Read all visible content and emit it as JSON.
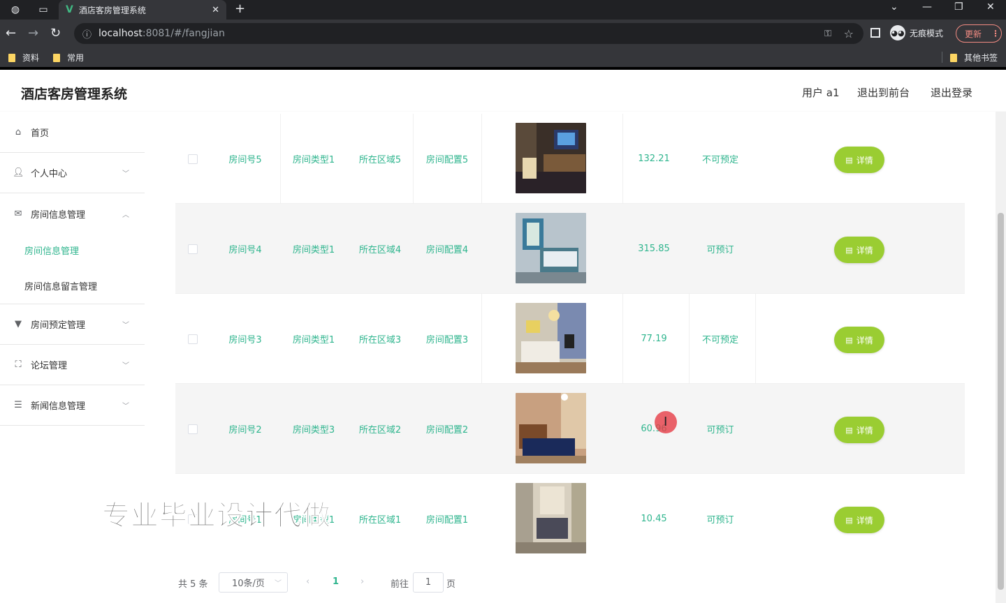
{
  "browser": {
    "tab_title": "酒店客房管理系统",
    "tab_logo": "V",
    "new_tab": "+",
    "url_host": "localhost",
    "url_rest": ":8081/#/fangjian",
    "incognito_label": "无痕模式",
    "update_label": "更新",
    "bookmarks": [
      "资料",
      "常用"
    ],
    "other_bookmarks": "其他书签"
  },
  "header": {
    "title": "酒店客房管理系统",
    "user": "用户 a1",
    "to_front": "退出到前台",
    "logout": "退出登录"
  },
  "sidebar": {
    "items": [
      {
        "label": "首页",
        "icon": "home-icon"
      },
      {
        "label": "个人中心",
        "icon": "user-icon"
      },
      {
        "label": "房间信息管理",
        "icon": "mail-icon"
      },
      {
        "label": "房间预定管理",
        "icon": "booking-icon"
      },
      {
        "label": "论坛管理",
        "icon": "forum-icon"
      },
      {
        "label": "新闻信息管理",
        "icon": "news-icon"
      }
    ],
    "sub_items": [
      "房间信息管理",
      "房间信息留言管理"
    ]
  },
  "table": {
    "detail_label": "详情",
    "rows": [
      {
        "room_no": "房间号5",
        "type": "房间类型1",
        "area": "所在区域5",
        "config": "房间配置5",
        "price": "132.21",
        "status": "不可预定"
      },
      {
        "room_no": "房间号4",
        "type": "房间类型1",
        "area": "所在区域4",
        "config": "房间配置4",
        "price": "315.85",
        "status": "可预订"
      },
      {
        "room_no": "房间号3",
        "type": "房间类型1",
        "area": "所在区域3",
        "config": "房间配置3",
        "price": "77.19",
        "status": "不可预定"
      },
      {
        "room_no": "房间号2",
        "type": "房间类型3",
        "area": "所在区域2",
        "config": "房间配置2",
        "price": "60.96",
        "status": "可预订"
      },
      {
        "room_no": "房间号1",
        "type": "房间类型1",
        "area": "所在区域1",
        "config": "房间配置1",
        "price": "10.45",
        "status": "可预订"
      }
    ]
  },
  "pagination": {
    "total": "共 5 条",
    "page_size": "10条/页",
    "current": "1",
    "goto_label": "前往",
    "goto_value": "1",
    "page_suffix": "页"
  },
  "overlay": {
    "watermark": "专业毕业设计代做",
    "cursor": "I"
  },
  "colors": {
    "accent": "#2fb58e",
    "detail_button": "#9acd32"
  }
}
